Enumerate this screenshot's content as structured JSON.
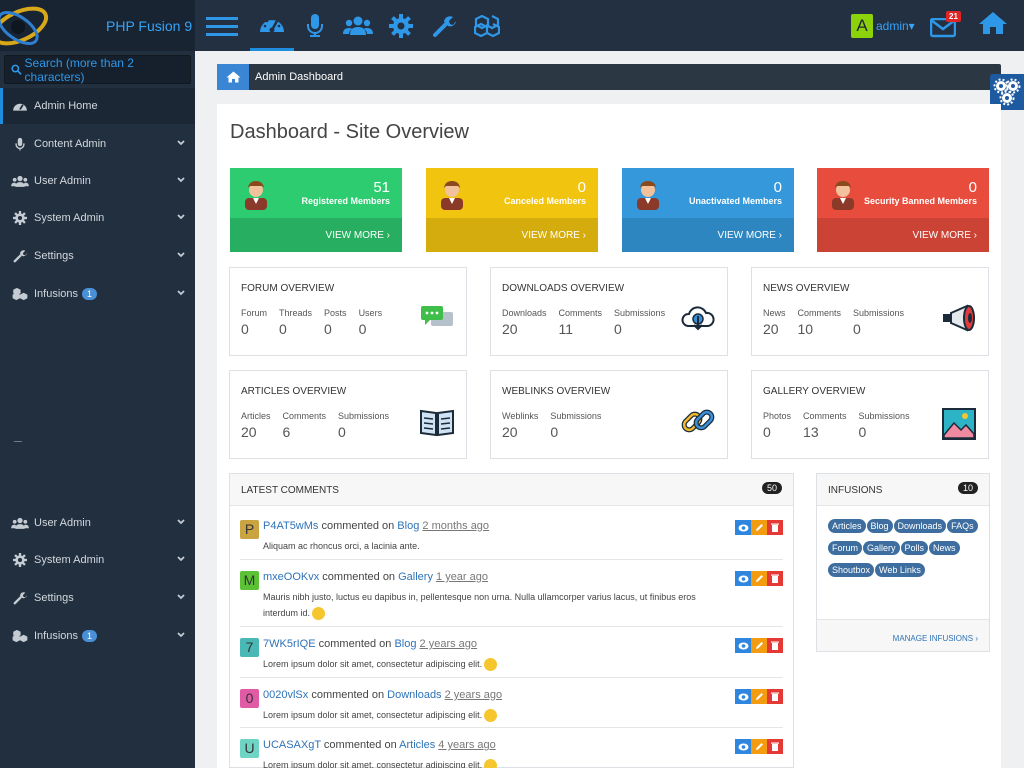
{
  "brand": "PHP Fusion 9",
  "user": {
    "avatar_letter": "A",
    "name": "admin▾",
    "mail_count": "21"
  },
  "search": {
    "placeholder": "Search (more than 2 characters)"
  },
  "sidebar": {
    "items": [
      {
        "label": "Admin Home",
        "icon": "dashboard-icon"
      },
      {
        "label": "Content Admin",
        "icon": "microphone-icon"
      },
      {
        "label": "User Admin",
        "icon": "users-icon"
      },
      {
        "label": "System Admin",
        "icon": "cog-icon"
      },
      {
        "label": "Settings",
        "icon": "wrench-icon"
      },
      {
        "label": "Infusions",
        "icon": "cubes-icon",
        "badge": "1"
      }
    ],
    "lower_items": [
      {
        "label": "User Admin",
        "icon": "users-icon"
      },
      {
        "label": "System Admin",
        "icon": "cog-icon"
      },
      {
        "label": "Settings",
        "icon": "wrench-icon"
      },
      {
        "label": "Infusions",
        "icon": "cubes-icon",
        "badge": "1"
      }
    ]
  },
  "breadcrumb": {
    "label": "Admin Dashboard"
  },
  "page": {
    "title": "Dashboard - Site Overview"
  },
  "stats": [
    {
      "num": "51",
      "label": "Registered Members",
      "more": "VIEW MORE ›",
      "color": "#2ecc71",
      "dark": "#27ae60"
    },
    {
      "num": "0",
      "label": "Canceled Members",
      "more": "VIEW MORE ›",
      "color": "#f1c40f",
      "dark": "#d4ac0d"
    },
    {
      "num": "0",
      "label": "Unactivated Members",
      "more": "VIEW MORE ›",
      "color": "#3498db",
      "dark": "#2e86c1"
    },
    {
      "num": "0",
      "label": "Security Banned Members",
      "more": "VIEW MORE ›",
      "color": "#e74c3c",
      "dark": "#cb4335"
    }
  ],
  "overviews": [
    {
      "title": "FORUM OVERVIEW",
      "icon": "chat-icon",
      "cols": [
        {
          "l": "Forum",
          "v": "0"
        },
        {
          "l": "Threads",
          "v": "0"
        },
        {
          "l": "Posts",
          "v": "0"
        },
        {
          "l": "Users",
          "v": "0"
        }
      ]
    },
    {
      "title": "DOWNLOADS OVERVIEW",
      "icon": "cloud-download-icon",
      "cols": [
        {
          "l": "Downloads",
          "v": "20"
        },
        {
          "l": "Comments",
          "v": "11"
        },
        {
          "l": "Submissions",
          "v": "0"
        }
      ]
    },
    {
      "title": "NEWS OVERVIEW",
      "icon": "megaphone-icon",
      "cols": [
        {
          "l": "News",
          "v": "20"
        },
        {
          "l": "Comments",
          "v": "10"
        },
        {
          "l": "Submissions",
          "v": "0"
        }
      ]
    },
    {
      "title": "ARTICLES OVERVIEW",
      "icon": "book-icon",
      "cols": [
        {
          "l": "Articles",
          "v": "20"
        },
        {
          "l": "Comments",
          "v": "6"
        },
        {
          "l": "Submissions",
          "v": "0"
        }
      ]
    },
    {
      "title": "WEBLINKS OVERVIEW",
      "icon": "chain-link-icon",
      "cols": [
        {
          "l": "Weblinks",
          "v": "20"
        },
        {
          "l": "Submissions",
          "v": "0"
        }
      ]
    },
    {
      "title": "GALLERY OVERVIEW",
      "icon": "picture-icon",
      "cols": [
        {
          "l": "Photos",
          "v": "0"
        },
        {
          "l": "Comments",
          "v": "13"
        },
        {
          "l": "Submissions",
          "v": "0"
        }
      ]
    }
  ],
  "comments": {
    "title": "LATEST COMMENTS",
    "count": "50",
    "items": [
      {
        "letter": "P",
        "color": "#c9a441",
        "user": "P4AT5wMs",
        "mid": " commented on ",
        "where": "Blog",
        "time": "2 months ago",
        "text": "Aliquam ac rhoncus orci, a lacinia ante.",
        "smile": false
      },
      {
        "letter": "M",
        "color": "#5bc236",
        "user": "mxeOOKvx",
        "mid": " commented on ",
        "where": "Gallery",
        "time": "1 year ago",
        "text": "Mauris nibh justo, luctus eu dapibus in, pellentesque non urna. Nulla ullamcorper varius lacus, ut finibus eros interdum id.",
        "smile": true
      },
      {
        "letter": "7",
        "color": "#4ab8b4",
        "user": "7WK5rIQE",
        "mid": " commented on ",
        "where": "Blog",
        "time": "2 years ago",
        "text": "Lorem ipsum dolor sit amet, consectetur adipiscing elit.",
        "smile": true
      },
      {
        "letter": "0",
        "color": "#e05aa6",
        "user": "0020vlSx",
        "mid": " commented on ",
        "where": "Downloads",
        "time": "2 years ago",
        "text": "Lorem ipsum dolor sit amet, consectetur adipiscing elit.",
        "smile": true
      },
      {
        "letter": "U",
        "color": "#6fd4c4",
        "user": "UCASAXgT",
        "mid": " commented on ",
        "where": "Articles",
        "time": "4 years ago",
        "text": "Lorem ipsum dolor sit amet, consectetur adipiscing elit.",
        "smile": true
      }
    ]
  },
  "infusions": {
    "title": "INFUSIONS",
    "count": "10",
    "tags": [
      "Articles",
      "Blog",
      "Downloads",
      "FAQs",
      "Forum",
      "Gallery",
      "Polls",
      "News",
      "Shoutbox",
      "Web Links"
    ],
    "manage": "MANAGE INFUSIONS ›"
  }
}
